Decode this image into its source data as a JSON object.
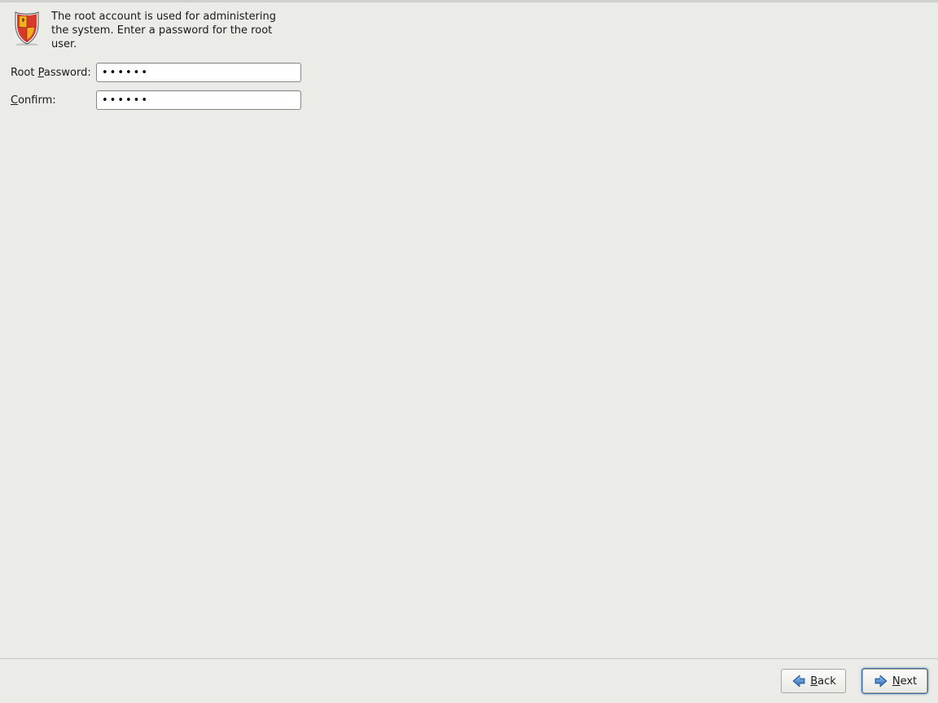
{
  "intro": {
    "text": "The root account is used for administering the system.  Enter a password for the root user."
  },
  "form": {
    "password_label_pre": "Root ",
    "password_label_hot": "P",
    "password_label_post": "assword:",
    "confirm_label_hot": "C",
    "confirm_label_post": "onfirm:",
    "password_value": "••••••",
    "confirm_value": "••••••"
  },
  "buttons": {
    "back_hot": "B",
    "back_rest": "ack",
    "next_hot": "N",
    "next_rest": "ext"
  }
}
